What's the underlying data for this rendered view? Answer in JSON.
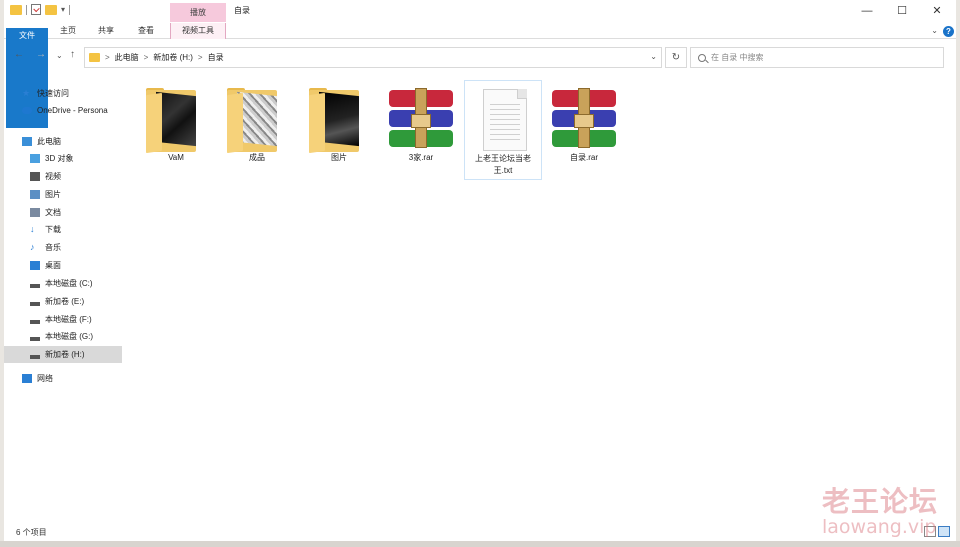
{
  "window": {
    "title": "自录",
    "context_tab_header": "播放",
    "controls": {
      "minimize": "—",
      "maximize": "☐",
      "close": "✕"
    }
  },
  "ribbon": {
    "tabs": [
      {
        "label": "文件"
      },
      {
        "label": "主页"
      },
      {
        "label": "共享"
      },
      {
        "label": "查看"
      },
      {
        "label": "视频工具"
      }
    ],
    "expand_caret": "⌄",
    "help": "?"
  },
  "navigation": {
    "back": "←",
    "forward": "→",
    "recent": "⌄",
    "up": "↑",
    "breadcrumb": [
      "此电脑",
      "新加卷 (H:)",
      "自录"
    ],
    "breadcrumb_sep": ">",
    "dropdown": "⌄",
    "refresh": "↻"
  },
  "search": {
    "placeholder": "在 自录 中搜索"
  },
  "sidebar": {
    "items": [
      {
        "label": "快速访问",
        "icon": "pin-icon",
        "color": "#2a7fd4"
      },
      {
        "label": "OneDrive - Persona",
        "icon": "cloud-icon",
        "color": "#1e78d0"
      },
      {
        "label": "此电脑",
        "icon": "computer-icon",
        "color": "#3a8fd8"
      },
      {
        "label": "3D 对象",
        "icon": "cube-icon",
        "color": "#4aa0e0"
      },
      {
        "label": "视频",
        "icon": "film-icon",
        "color": "#555555"
      },
      {
        "label": "图片",
        "icon": "picture-icon",
        "color": "#5b8fc4"
      },
      {
        "label": "文档",
        "icon": "document-icon",
        "color": "#7a8aa0"
      },
      {
        "label": "下载",
        "icon": "download-icon",
        "color": "#2a7fd4"
      },
      {
        "label": "音乐",
        "icon": "music-icon",
        "color": "#2a7fd4"
      },
      {
        "label": "桌面",
        "icon": "desktop-icon",
        "color": "#2a7fd4"
      },
      {
        "label": "本地磁盘 (C:)",
        "icon": "drive-icon",
        "color": "#555555"
      },
      {
        "label": "新加卷 (E:)",
        "icon": "drive-icon",
        "color": "#555555"
      },
      {
        "label": "本地磁盘 (F:)",
        "icon": "drive-icon",
        "color": "#555555"
      },
      {
        "label": "本地磁盘 (G:)",
        "icon": "drive-icon",
        "color": "#555555"
      },
      {
        "label": "新加卷 (H:)",
        "icon": "drive-icon",
        "color": "#555555",
        "selected": true
      },
      {
        "label": "网络",
        "icon": "network-icon",
        "color": "#2a7fd4"
      }
    ]
  },
  "files": [
    {
      "name": "VaM",
      "type": "folder"
    },
    {
      "name": "成品",
      "type": "folder"
    },
    {
      "name": "图片",
      "type": "folder"
    },
    {
      "name": "3家.rar",
      "type": "rar"
    },
    {
      "name": "上老王论坛当老王.txt",
      "type": "txt",
      "selected": true
    },
    {
      "name": "自录.rar",
      "type": "rar"
    }
  ],
  "status": {
    "item_count": "6 个项目"
  },
  "watermark": {
    "line1": "老王论坛",
    "line2": "laowang.vip"
  },
  "colors": {
    "file_tab": "#1979ca",
    "context_tab": "#f6c9dc",
    "folder": "#f0c96a",
    "selection": "#d9d9d9"
  }
}
